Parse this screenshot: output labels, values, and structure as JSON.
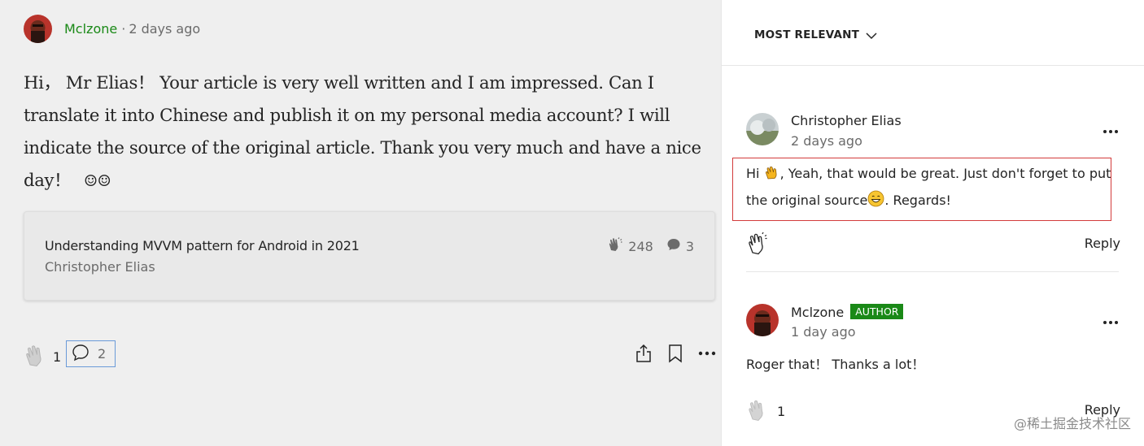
{
  "main_comment": {
    "author": "Mclzone",
    "separator": "·",
    "time": "2 days ago",
    "text": "Hi，  Mr Elias！ Your article is very well written and I am impressed. Can I translate it into Chinese and publish it on my personal media account? I will indicate the source of the original article. Thank you very much and have a nice day！",
    "smileys": "☺☺"
  },
  "article_card": {
    "title": "Understanding MVVM pattern for Android in 2021",
    "author": "Christopher Elias",
    "claps": "248",
    "responses": "3"
  },
  "action_bar": {
    "claps": "1",
    "responses": "2"
  },
  "sort": {
    "label": "MOST RELEVANT"
  },
  "responses": [
    {
      "author": "Christopher Elias",
      "time": "2 days ago",
      "text_part1": "Hi ",
      "text_part2": ", Yeah, that would be great. Just don't forget to put",
      "text_line2_part1": "the original source",
      "text_line2_part2": ". Regards!",
      "reply_label": "Reply"
    },
    {
      "author": "Mclzone",
      "badge": "AUTHOR",
      "time": "1 day ago",
      "text": "Roger that！ Thanks a lot！",
      "claps": "1",
      "reply_label": "Reply"
    }
  ],
  "watermark": "@稀土掘金技术社区",
  "colors": {
    "accent_green": "#1a8917",
    "highlight_red": "#d33b3b",
    "focus_blue": "#6a9ad8"
  }
}
